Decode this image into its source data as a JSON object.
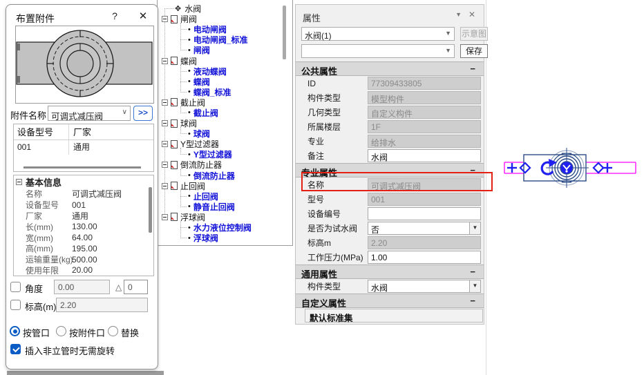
{
  "dialog": {
    "title": "布置附件",
    "help_icon": "?",
    "close_icon": "✕",
    "accessory_label": "附件名称",
    "accessory_value": "可调式减压阀",
    "expand_button": ">>",
    "table": {
      "headers": [
        "设备型号",
        "厂家"
      ],
      "rows": [
        [
          "001",
          "通用"
        ]
      ]
    },
    "basic_info": {
      "title": "基本信息",
      "rows": [
        {
          "label": "名称",
          "value": "可调式减压阀"
        },
        {
          "label": "设备型号",
          "value": "001"
        },
        {
          "label": "厂家",
          "value": "通用"
        },
        {
          "label": "长(mm)",
          "value": "130.00"
        },
        {
          "label": "宽(mm)",
          "value": "64.00"
        },
        {
          "label": "高(mm)",
          "value": "195.00"
        },
        {
          "label": "运输重量(kg)",
          "value": "500.00"
        },
        {
          "label": "使用年限",
          "value": "20.00"
        }
      ]
    },
    "angle": {
      "label": "角度",
      "value": "0.00",
      "delta_icon": "△",
      "delta_value": "0",
      "checked": false
    },
    "elevation": {
      "label": "标高(m)",
      "value": "2.20",
      "checked": false
    },
    "radios": [
      {
        "label": "按管口",
        "selected": true
      },
      {
        "label": "按附件口",
        "selected": false
      },
      {
        "label": "替换",
        "selected": false
      }
    ],
    "rotate_checkbox": {
      "label": "插入非立管时无需旋转",
      "checked": true
    }
  },
  "tree": {
    "items": [
      {
        "type": "root",
        "label": "水阀"
      },
      {
        "type": "group",
        "label": "闸阀"
      },
      {
        "type": "leaf",
        "label": "电动闸阀"
      },
      {
        "type": "leaf",
        "label": "电动闸阀_标准"
      },
      {
        "type": "leaf",
        "label": "闸阀"
      },
      {
        "type": "group",
        "label": "蝶阀"
      },
      {
        "type": "leaf",
        "label": "液动蝶阀"
      },
      {
        "type": "leaf",
        "label": "蝶阀"
      },
      {
        "type": "leaf",
        "label": "蝶阀_标准"
      },
      {
        "type": "group",
        "label": "截止阀"
      },
      {
        "type": "leaf",
        "label": "截止阀"
      },
      {
        "type": "group",
        "label": "球阀"
      },
      {
        "type": "leaf",
        "label": "球阀"
      },
      {
        "type": "group",
        "label": "Y型过滤器"
      },
      {
        "type": "leaf",
        "label": "Y型过滤器"
      },
      {
        "type": "group",
        "label": "倒流防止器"
      },
      {
        "type": "leaf",
        "label": "倒流防止器"
      },
      {
        "type": "group",
        "label": "止回阀"
      },
      {
        "type": "leaf",
        "label": "止回阀"
      },
      {
        "type": "leaf",
        "label": "静音止回阀"
      },
      {
        "type": "group",
        "label": "浮球阀"
      },
      {
        "type": "leaf",
        "label": "水力液位控制阀"
      },
      {
        "type": "leaf",
        "label": "浮球阀"
      }
    ]
  },
  "properties": {
    "title": "属性",
    "caret_icon": "▼",
    "close_icon": "✕",
    "combo1": "水阀(1)",
    "combo2": "",
    "btn_schematic": "示意图",
    "btn_save": "保存",
    "sections": [
      {
        "title": "公共属性",
        "minus": "−",
        "rows": [
          {
            "label": "ID",
            "value": "77309433805",
            "state": "disabled"
          },
          {
            "label": "构件类型",
            "value": "模型构件",
            "state": "disabled"
          },
          {
            "label": "几何类型",
            "value": "自定义构件",
            "state": "disabled"
          },
          {
            "label": "所属楼层",
            "value": "1F",
            "state": "disabled"
          },
          {
            "label": "专业",
            "value": "给排水",
            "state": "disabled"
          },
          {
            "label": "备注",
            "value": "水阀",
            "state": "editable"
          }
        ]
      },
      {
        "title": "专业属性",
        "minus": "−",
        "rows": [
          {
            "label": "名称",
            "value": "可调式减压阀",
            "state": "disabled"
          },
          {
            "label": "型号",
            "value": "001",
            "state": "disabled"
          },
          {
            "label": "设备编号",
            "value": "",
            "state": "editable"
          },
          {
            "label": "是否为试水阀",
            "value": "否",
            "state": "dropdown"
          },
          {
            "label": "标高m",
            "value": "2.20",
            "state": "disabled"
          },
          {
            "label": "工作压力(MPa)",
            "value": "1.00",
            "state": "editable"
          }
        ]
      },
      {
        "title": "通用属性",
        "minus": "−",
        "rows": [
          {
            "label": "构件类型",
            "value": "水阀",
            "state": "dropdown"
          }
        ]
      },
      {
        "title": "自定义属性",
        "minus": "−",
        "rows": [],
        "subheader": "默认标准集"
      }
    ]
  },
  "colors": {
    "accent_blue": "#0b5cc4",
    "tree_link_blue": "#1212d9",
    "annotation_red": "#e32012",
    "pipe_magenta": "#ff00ff",
    "valve_navy": "#2a4a86",
    "grip_blue": "#2020f0",
    "disabled_fill": "#cecece"
  }
}
